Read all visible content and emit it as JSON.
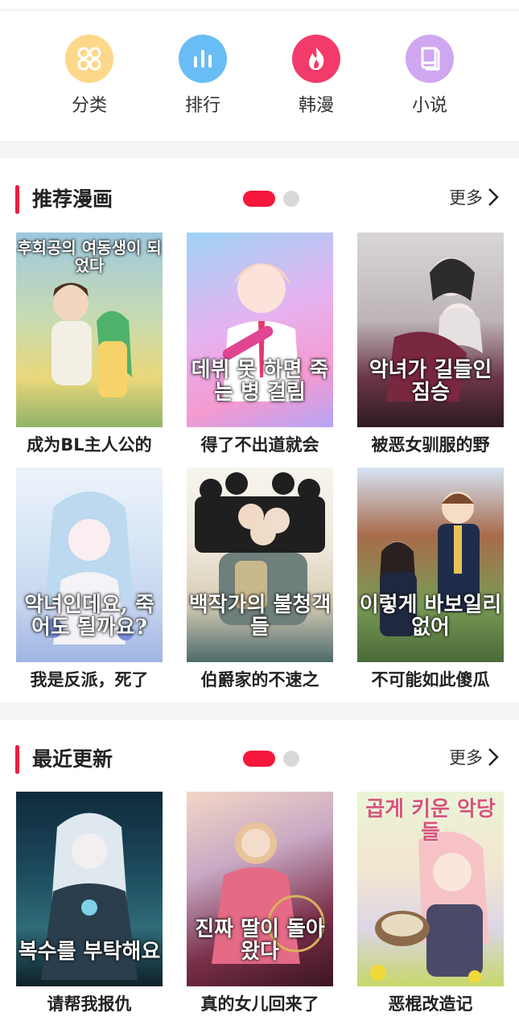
{
  "nav": [
    {
      "label": "分类",
      "icon": "grid-icon",
      "color": "#fdd88a"
    },
    {
      "label": "排行",
      "icon": "bar-chart-icon",
      "color": "#68bdf5"
    },
    {
      "label": "韩漫",
      "icon": "flame-icon",
      "color": "#f23b6a"
    },
    {
      "label": "小说",
      "icon": "book-icon",
      "color": "#cfa7f0"
    }
  ],
  "sections": [
    {
      "title": "推荐漫画",
      "more_label": "更多",
      "items": [
        {
          "title": "成为BL主人公的",
          "cover_text": "후회공의 여동생이 되었다"
        },
        {
          "title": "得了不出道就会",
          "cover_text": "데뷔 못 하면 죽는 병 걸림"
        },
        {
          "title": "被恶女驯服的野",
          "cover_text": "악녀가 길들인 짐승"
        },
        {
          "title": "我是反派，死了",
          "cover_text": "악녀인데요, 죽어도 될까요?"
        },
        {
          "title": "伯爵家的不速之",
          "cover_text": "백작가의 불청객들"
        },
        {
          "title": "不可能如此傻瓜",
          "cover_text": "이렇게 바보일리 없어"
        }
      ]
    },
    {
      "title": "最近更新",
      "more_label": "更多",
      "items": [
        {
          "title": "请帮我报仇",
          "cover_text": "복수를 부탁해요"
        },
        {
          "title": "真的女儿回来了",
          "cover_text": "진짜 딸이 돌아왔다"
        },
        {
          "title": "恶棍改造记",
          "cover_text": "곱게 키운 악당들"
        }
      ]
    }
  ]
}
